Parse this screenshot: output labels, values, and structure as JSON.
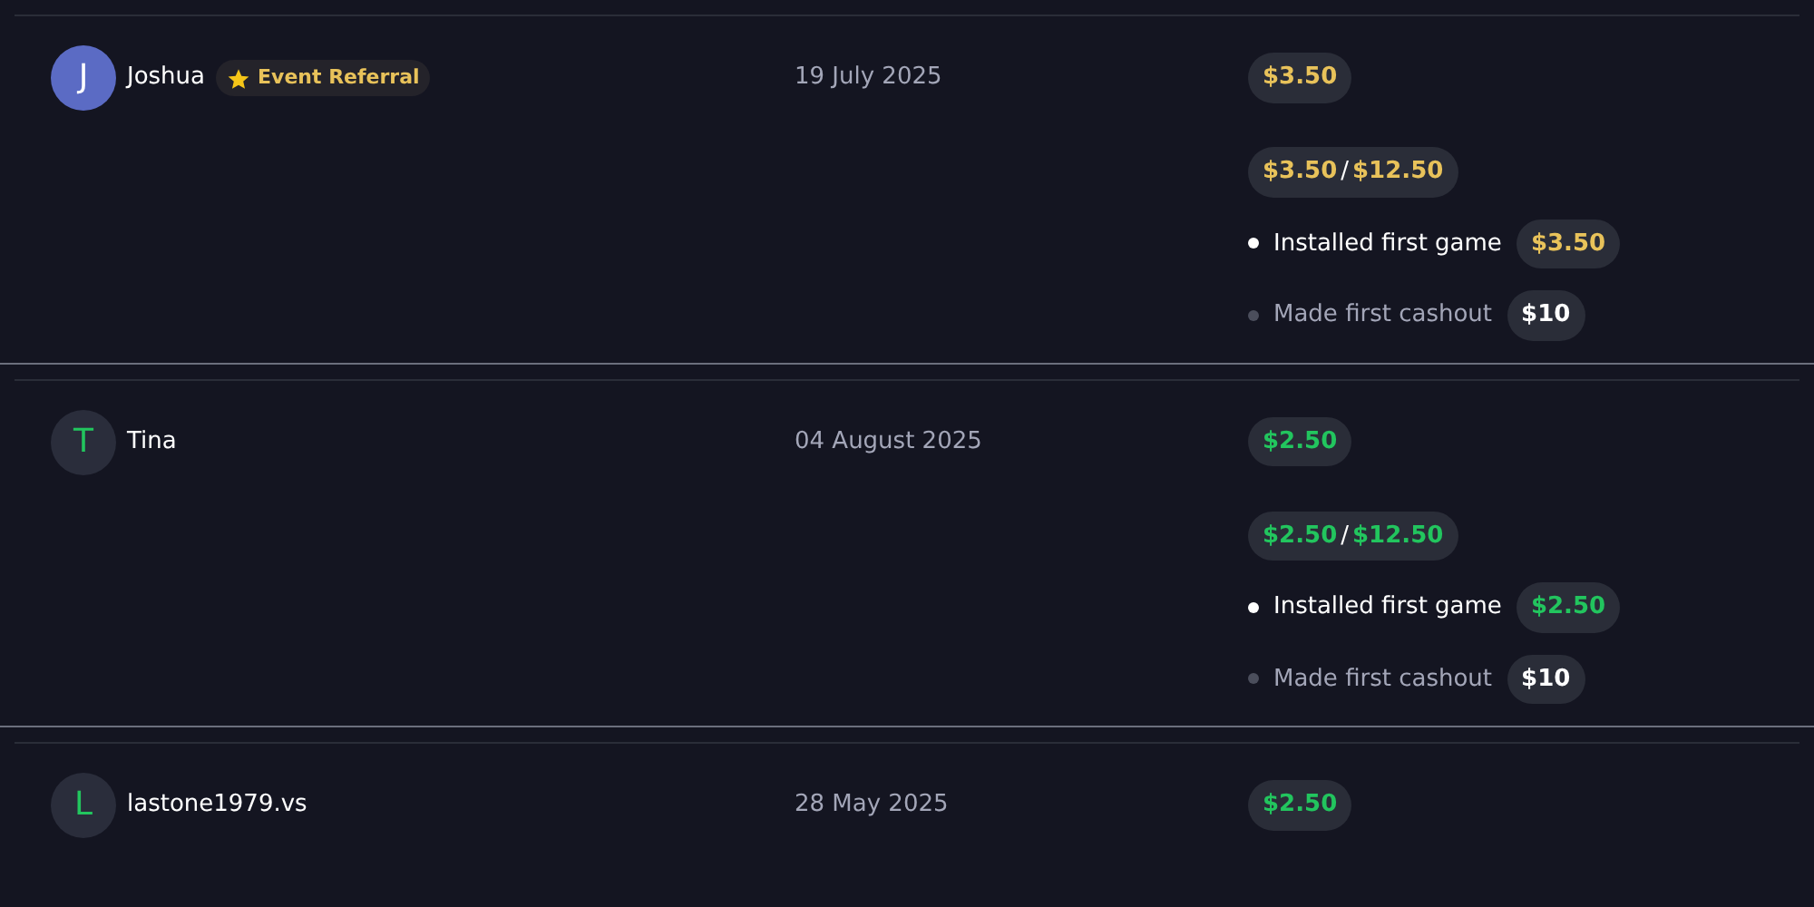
{
  "referrals": [
    {
      "avatar": {
        "letter": "J",
        "kind": "filled",
        "color": "#5b6bc4"
      },
      "name": "Joshua",
      "badge": {
        "label": "Event Referral"
      },
      "date": "19 July 2025",
      "color": "#e8c25a",
      "earned": "$3.50",
      "progress": {
        "current": "$3.50",
        "separator": "/",
        "total": "$12.50"
      },
      "milestones": [
        {
          "label": "Installed first game",
          "amount": "$3.50",
          "done": true
        },
        {
          "label": "Made first cashout",
          "amount": "$10",
          "done": false
        }
      ]
    },
    {
      "avatar": {
        "letter": "T",
        "kind": "plain"
      },
      "name": "Tina",
      "date": "04 August 2025",
      "color": "#22c55e",
      "earned": "$2.50",
      "progress": {
        "current": "$2.50",
        "separator": "/",
        "total": "$12.50"
      },
      "milestones": [
        {
          "label": "Installed first game",
          "amount": "$2.50",
          "done": true
        },
        {
          "label": "Made first cashout",
          "amount": "$10",
          "done": false
        }
      ]
    },
    {
      "avatar": {
        "letter": "L",
        "kind": "plain"
      },
      "name": "lastone1979.vs",
      "date": "28 May 2025",
      "color": "#22c55e",
      "earned": "$2.50"
    }
  ]
}
